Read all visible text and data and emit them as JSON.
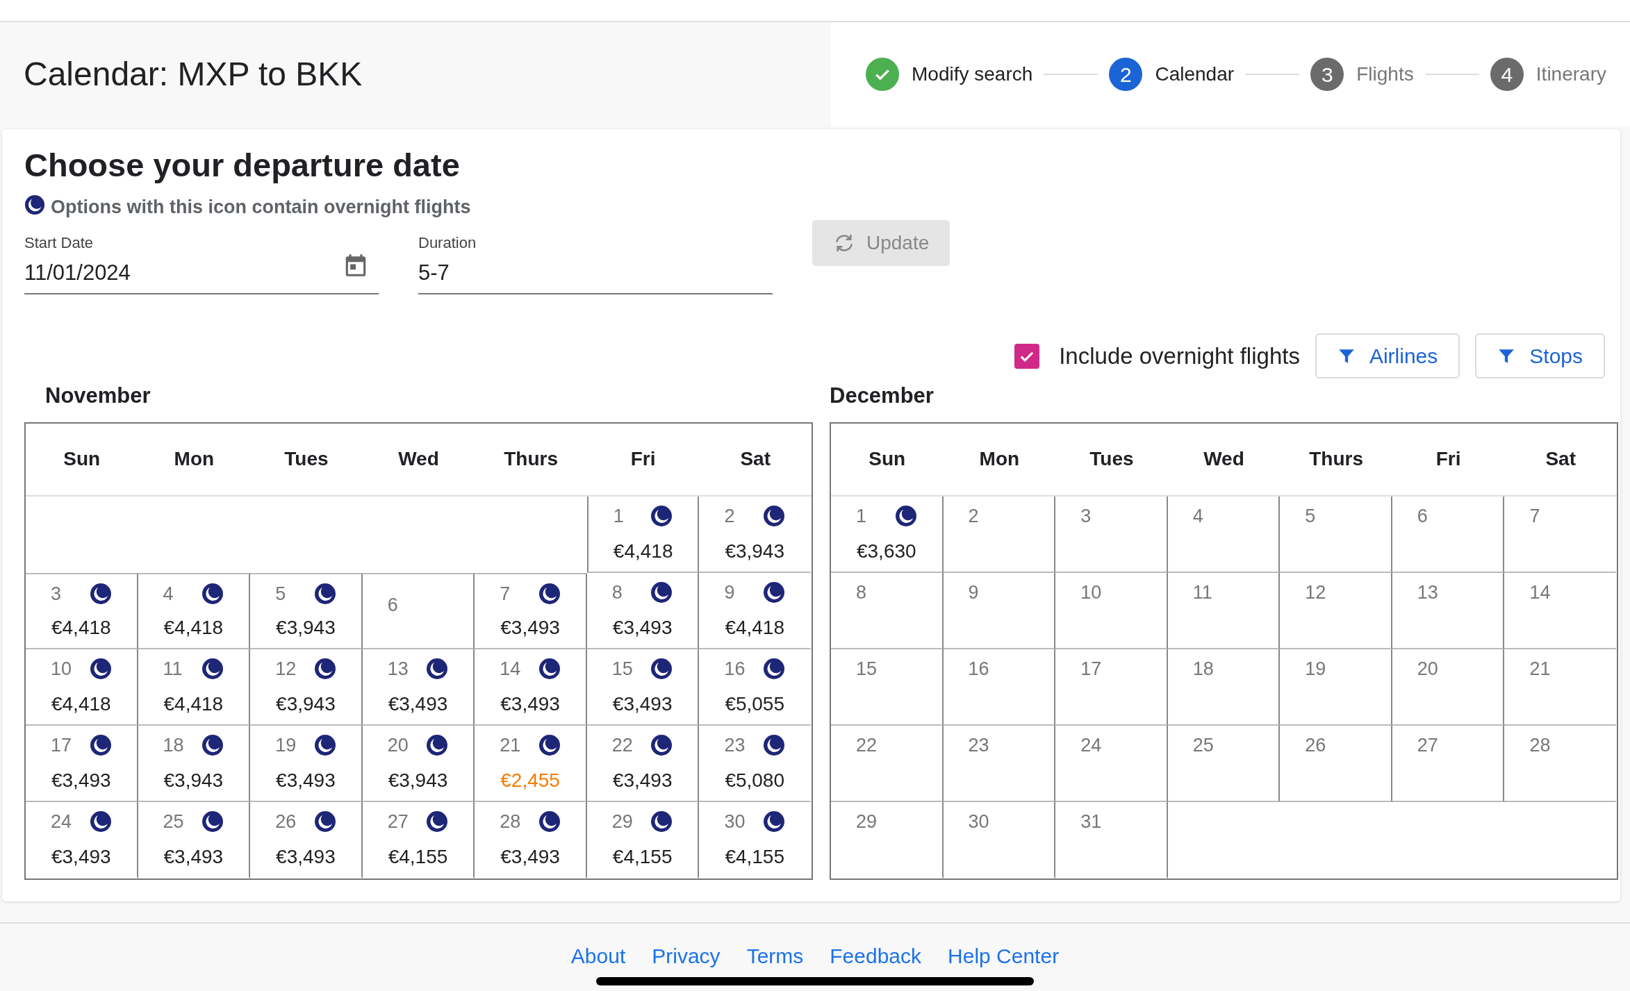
{
  "header": {
    "title": "Calendar: MXP to BKK"
  },
  "steps": [
    {
      "label": "Modify search",
      "completed": true,
      "selected": false
    },
    {
      "number": "2",
      "label": "Calendar",
      "completed": false,
      "selected": true
    },
    {
      "number": "3",
      "label": "Flights",
      "completed": false,
      "selected": false
    },
    {
      "number": "4",
      "label": "Itinerary",
      "completed": false,
      "selected": false
    }
  ],
  "card": {
    "title": "Choose your departure date",
    "legend": "Options with this icon contain overnight flights",
    "fields": [
      {
        "label": "Start Date",
        "value": "11/01/2024",
        "kind": "date"
      },
      {
        "label": "Duration",
        "value": "5-7",
        "kind": "text"
      }
    ],
    "update_button": {
      "label": "Update",
      "disabled": true
    },
    "overnight_option": {
      "label": "Include overnight flights",
      "checked": true
    },
    "filters": [
      "Airlines",
      "Stops"
    ],
    "months": [
      {
        "name": "November",
        "weekdays": [
          "Sun",
          "Mon",
          "Tues",
          "Wed",
          "Thurs",
          "Fri",
          "Sat"
        ],
        "weeks": [
          {
            "kind": "endfill",
            "days": [
              {
                "day": "1",
                "price": "€4,418",
                "overnight": true,
                "cheapest": false
              },
              {
                "day": "2",
                "price": "€3,943",
                "overnight": true,
                "cheapest": false
              }
            ]
          },
          {
            "kind": "startfill",
            "days": [
              {
                "day": "3",
                "price": "€4,418",
                "overnight": true,
                "cheapest": false
              },
              {
                "day": "4",
                "price": "€4,418",
                "overnight": true,
                "cheapest": false
              },
              {
                "day": "5",
                "price": "€3,943",
                "overnight": true,
                "cheapest": false
              },
              {
                "day": "6",
                "overnight": false
              },
              {
                "day": "7",
                "price": "€3,493",
                "overnight": true,
                "cheapest": false
              },
              {
                "day": "8",
                "price": "€3,493",
                "overnight": true,
                "cheapest": false
              },
              {
                "day": "9",
                "price": "€4,418",
                "overnight": true,
                "cheapest": false
              }
            ]
          },
          {
            "kind": "startfill",
            "days": [
              {
                "day": "10",
                "price": "€4,418",
                "overnight": true,
                "cheapest": false
              },
              {
                "day": "11",
                "price": "€4,418",
                "overnight": true,
                "cheapest": false
              },
              {
                "day": "12",
                "price": "€3,943",
                "overnight": true,
                "cheapest": false
              },
              {
                "day": "13",
                "price": "€3,493",
                "overnight": true,
                "cheapest": false
              },
              {
                "day": "14",
                "price": "€3,493",
                "overnight": true,
                "cheapest": false
              },
              {
                "day": "15",
                "price": "€3,493",
                "overnight": true,
                "cheapest": false
              },
              {
                "day": "16",
                "price": "€5,055",
                "overnight": true,
                "cheapest": false
              }
            ]
          },
          {
            "kind": "startfill",
            "days": [
              {
                "day": "17",
                "price": "€3,493",
                "overnight": true,
                "cheapest": false
              },
              {
                "day": "18",
                "price": "€3,943",
                "overnight": true,
                "cheapest": false
              },
              {
                "day": "19",
                "price": "€3,493",
                "overnight": true,
                "cheapest": false
              },
              {
                "day": "20",
                "price": "€3,943",
                "overnight": true,
                "cheapest": false
              },
              {
                "day": "21",
                "price": "€2,455",
                "overnight": true,
                "cheapest": true
              },
              {
                "day": "22",
                "price": "€3,493",
                "overnight": true,
                "cheapest": false
              },
              {
                "day": "23",
                "price": "€5,080",
                "overnight": true,
                "cheapest": false
              }
            ]
          },
          {
            "kind": "startfill",
            "days": [
              {
                "day": "24",
                "price": "€3,493",
                "overnight": true,
                "cheapest": false
              },
              {
                "day": "25",
                "price": "€3,493",
                "overnight": true,
                "cheapest": false
              },
              {
                "day": "26",
                "price": "€3,493",
                "overnight": true,
                "cheapest": false
              },
              {
                "day": "27",
                "price": "€4,155",
                "overnight": true,
                "cheapest": false
              },
              {
                "day": "28",
                "price": "€3,493",
                "overnight": true,
                "cheapest": false
              },
              {
                "day": "29",
                "price": "€4,155",
                "overnight": true,
                "cheapest": false
              },
              {
                "day": "30",
                "price": "€4,155",
                "overnight": true,
                "cheapest": false
              }
            ]
          }
        ]
      },
      {
        "name": "December",
        "weekdays": [
          "Sun",
          "Mon",
          "Tues",
          "Wed",
          "Thurs",
          "Fri",
          "Sat"
        ],
        "weeks": [
          {
            "kind": "startfill",
            "days": [
              {
                "day": "1",
                "price": "€3,630",
                "overnight": true,
                "cheapest": false
              },
              {
                "day": "2",
                "overnight": false
              },
              {
                "day": "3",
                "overnight": false
              },
              {
                "day": "4",
                "overnight": false
              },
              {
                "day": "5",
                "overnight": false
              },
              {
                "day": "6",
                "overnight": false
              },
              {
                "day": "7",
                "overnight": false
              }
            ]
          },
          {
            "kind": "startfill",
            "days": [
              {
                "day": "8",
                "overnight": false
              },
              {
                "day": "9",
                "overnight": false
              },
              {
                "day": "10",
                "overnight": false
              },
              {
                "day": "11",
                "overnight": false
              },
              {
                "day": "12",
                "overnight": false
              },
              {
                "day": "13",
                "overnight": false
              },
              {
                "day": "14",
                "overnight": false
              }
            ]
          },
          {
            "kind": "startfill",
            "days": [
              {
                "day": "15",
                "overnight": false
              },
              {
                "day": "16",
                "overnight": false
              },
              {
                "day": "17",
                "overnight": false
              },
              {
                "day": "18",
                "overnight": false
              },
              {
                "day": "19",
                "overnight": false
              },
              {
                "day": "20",
                "overnight": false
              },
              {
                "day": "21",
                "overnight": false
              }
            ]
          },
          {
            "kind": "startfill",
            "days": [
              {
                "day": "22",
                "overnight": false
              },
              {
                "day": "23",
                "overnight": false
              },
              {
                "day": "24",
                "overnight": false
              },
              {
                "day": "25",
                "overnight": false
              },
              {
                "day": "26",
                "overnight": false
              },
              {
                "day": "27",
                "overnight": false
              },
              {
                "day": "28",
                "overnight": false
              }
            ]
          },
          {
            "kind": "startfill",
            "days": [
              {
                "day": "29",
                "overnight": false
              },
              {
                "day": "30",
                "overnight": false
              },
              {
                "day": "31",
                "overnight": false
              }
            ]
          }
        ]
      }
    ]
  },
  "footer": {
    "links": [
      "About",
      "Privacy",
      "Terms",
      "Feedback",
      "Help Center"
    ]
  }
}
